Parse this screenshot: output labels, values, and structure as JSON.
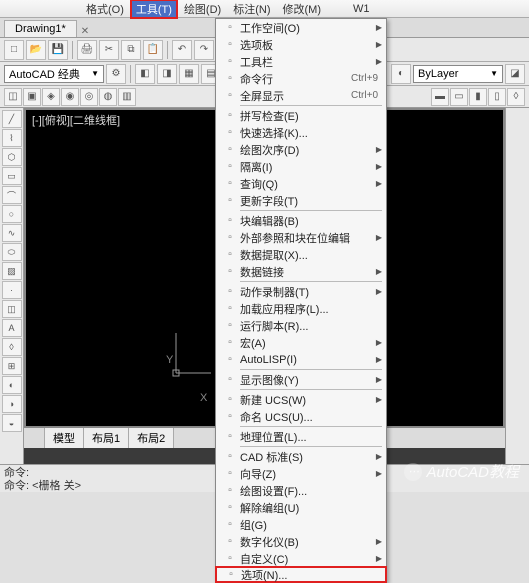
{
  "menubar": [
    "格式(O)",
    "工具(T)",
    "绘图(D)",
    "标注(N)",
    "修改(M)",
    "",
    "W1"
  ],
  "menubar_active_index": 1,
  "file_tab": "Drawing1*",
  "workspace_combo": "AutoCAD 经典",
  "bylayer": "ByLayer",
  "canvas_title": "[-][俯视][二维线框]",
  "ucs": {
    "x": "X",
    "y": "Y"
  },
  "bottom_tabs": [
    "模型",
    "布局1",
    "布局2"
  ],
  "cmd": {
    "line1": "命令:",
    "line2": "命令: <栅格 关>"
  },
  "watermark": "AutoCAD教程",
  "menu": {
    "items": [
      {
        "label": "工作空间(O)",
        "arrow": true
      },
      {
        "label": "选项板",
        "arrow": true
      },
      {
        "label": "工具栏",
        "arrow": true
      },
      {
        "label": "命令行",
        "shortcut": "Ctrl+9"
      },
      {
        "label": "全屏显示",
        "shortcut": "Ctrl+0"
      },
      {
        "sep": true
      },
      {
        "label": "拼写检查(E)"
      },
      {
        "label": "快速选择(K)..."
      },
      {
        "label": "绘图次序(D)",
        "arrow": true
      },
      {
        "label": "隔离(I)",
        "arrow": true
      },
      {
        "label": "查询(Q)",
        "arrow": true
      },
      {
        "label": "更新字段(T)"
      },
      {
        "sep": true
      },
      {
        "label": "块编辑器(B)"
      },
      {
        "label": "外部参照和块在位编辑",
        "arrow": true
      },
      {
        "label": "数据提取(X)..."
      },
      {
        "label": "数据链接",
        "arrow": true
      },
      {
        "sep": true
      },
      {
        "label": "动作录制器(T)",
        "arrow": true
      },
      {
        "label": "加载应用程序(L)..."
      },
      {
        "label": "运行脚本(R)..."
      },
      {
        "label": "宏(A)",
        "arrow": true
      },
      {
        "label": "AutoLISP(I)",
        "arrow": true
      },
      {
        "sep": true
      },
      {
        "label": "显示图像(Y)",
        "arrow": true
      },
      {
        "sep": true
      },
      {
        "label": "新建 UCS(W)",
        "arrow": true
      },
      {
        "label": "命名 UCS(U)..."
      },
      {
        "sep": true
      },
      {
        "label": "地理位置(L)..."
      },
      {
        "sep": true
      },
      {
        "label": "CAD 标准(S)",
        "arrow": true
      },
      {
        "label": "向导(Z)",
        "arrow": true
      },
      {
        "label": "绘图设置(F)..."
      },
      {
        "label": "解除编组(U)"
      },
      {
        "label": "组(G)"
      },
      {
        "label": "数字化仪(B)",
        "arrow": true
      },
      {
        "label": "自定义(C)",
        "arrow": true
      },
      {
        "label": "选项(N)...",
        "boxed": true
      }
    ]
  }
}
